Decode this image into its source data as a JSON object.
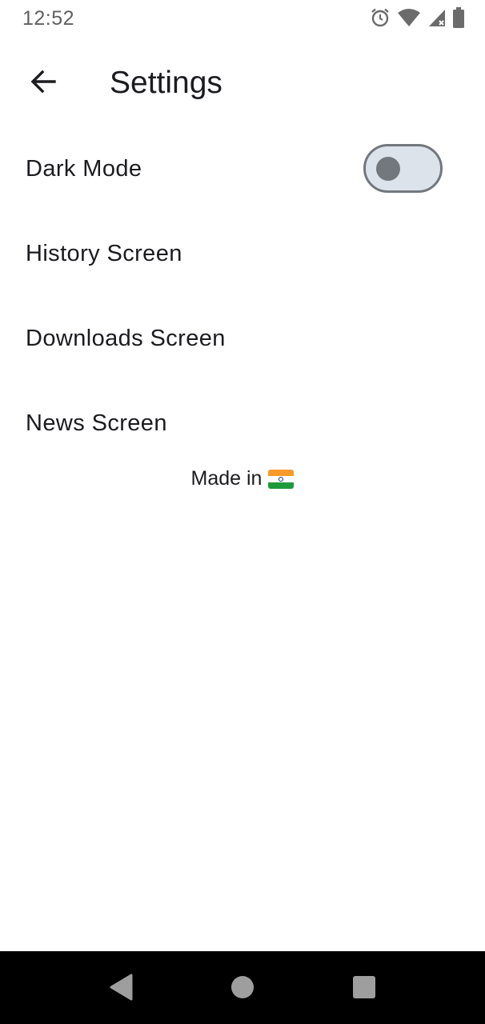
{
  "status_bar": {
    "time": "12:52",
    "icons": [
      "alarm-icon",
      "wifi-icon",
      "cell-signal-icon",
      "battery-icon"
    ]
  },
  "app_bar": {
    "back_icon": "arrow-left-icon",
    "title": "Settings"
  },
  "settings": {
    "items": [
      {
        "label": "Dark Mode",
        "control": "toggle",
        "enabled": false
      },
      {
        "label": "History Screen"
      },
      {
        "label": "Downloads Screen"
      },
      {
        "label": "News Screen"
      }
    ]
  },
  "footer": {
    "text": "Made in",
    "flag_icon": "india-flag-icon"
  },
  "nav_bar": {
    "buttons": [
      "back-triangle-icon",
      "home-circle-icon",
      "recents-square-icon"
    ]
  },
  "colors": {
    "background": "#ffffff",
    "text": "#1c1b1f",
    "toggle_track": "#dde3ea",
    "toggle_outline": "#72787e",
    "nav_bar": "#000000"
  }
}
